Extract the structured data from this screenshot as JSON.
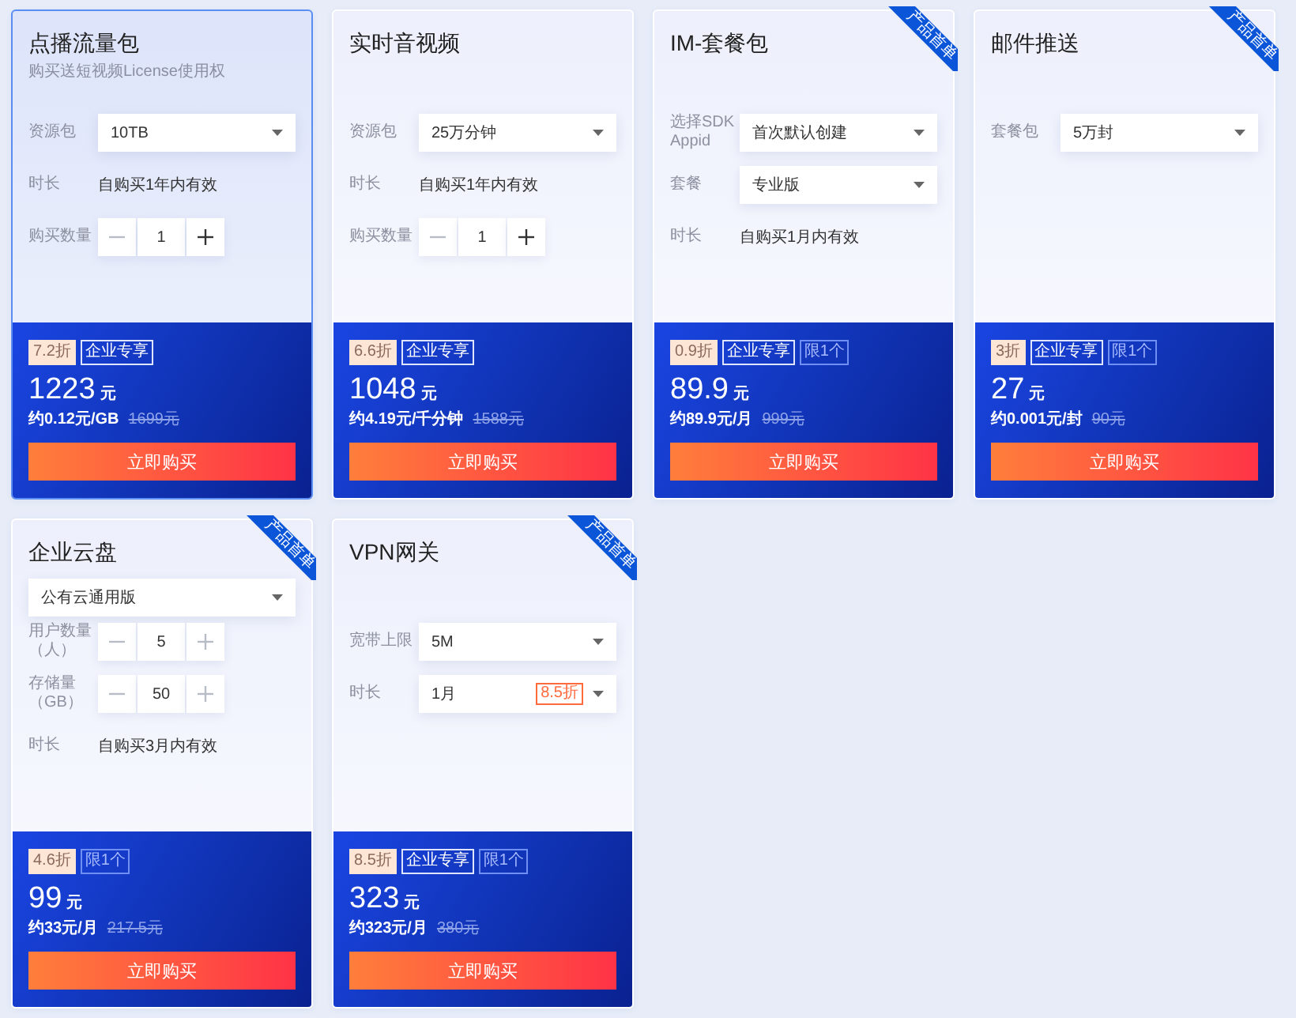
{
  "cards": [
    {
      "title": "点播流量包",
      "subtitle": "购买送短视频License使用权",
      "selected": true,
      "fields": [
        {
          "kind": "select",
          "label": "资源包",
          "value": "10TB"
        },
        {
          "kind": "text",
          "label": "时长",
          "value": "自购买1年内有效"
        },
        {
          "kind": "stepper",
          "label": "购买数量",
          "value": "1",
          "minus_disabled": true,
          "plus_disabled": false
        }
      ],
      "tags": [
        {
          "kind": "discount",
          "text": "7.2折"
        },
        {
          "kind": "exclusive",
          "text": "企业专享"
        }
      ],
      "price": "1223",
      "currency": "元",
      "unit_price": "约0.12元/GB",
      "original_price": "1699元",
      "button": "立即购买"
    },
    {
      "title": "实时音视频",
      "selected": false,
      "fields": [
        {
          "kind": "select",
          "label": "资源包",
          "value": "25万分钟"
        },
        {
          "kind": "text",
          "label": "时长",
          "value": "自购买1年内有效"
        },
        {
          "kind": "stepper",
          "label": "购买数量",
          "value": "1",
          "minus_disabled": true,
          "plus_disabled": false
        }
      ],
      "tags": [
        {
          "kind": "discount",
          "text": "6.6折"
        },
        {
          "kind": "exclusive",
          "text": "企业专享"
        }
      ],
      "price": "1048",
      "currency": "元",
      "unit_price": "约4.19元/千分钟",
      "original_price": "1588元",
      "button": "立即购买"
    },
    {
      "title": "IM-套餐包",
      "ribbon": "产品首单",
      "selected": false,
      "fields": [
        {
          "kind": "select",
          "label": "选择SDK Appid",
          "value": "首次默认创建"
        },
        {
          "kind": "select",
          "label": "套餐",
          "value": "专业版"
        },
        {
          "kind": "text",
          "label": "时长",
          "value": "自购买1月内有效"
        }
      ],
      "tags": [
        {
          "kind": "discount",
          "text": "0.9折"
        },
        {
          "kind": "exclusive",
          "text": "企业专享"
        },
        {
          "kind": "limit",
          "text": "限1个"
        }
      ],
      "price": "89.9",
      "currency": "元",
      "unit_price": "约89.9元/月",
      "original_price": "999元",
      "button": "立即购买"
    },
    {
      "title": "邮件推送",
      "ribbon": "产品首单",
      "selected": false,
      "fields": [
        {
          "kind": "select",
          "label": "套餐包",
          "value": "5万封"
        }
      ],
      "tags": [
        {
          "kind": "discount",
          "text": "3折"
        },
        {
          "kind": "exclusive",
          "text": "企业专享"
        },
        {
          "kind": "limit",
          "text": "限1个"
        }
      ],
      "price": "27",
      "currency": "元",
      "unit_price": "约0.001元/封",
      "original_price": "90元",
      "button": "立即购买"
    },
    {
      "title": "企业云盘",
      "ribbon": "产品首单",
      "selected": false,
      "edition": "公有云通用版",
      "fields": [
        {
          "kind": "stepper",
          "label": "用户数量（人）",
          "value": "5",
          "minus_disabled": true,
          "plus_disabled": true
        },
        {
          "kind": "stepper",
          "label": "存储量（GB）",
          "value": "50",
          "minus_disabled": true,
          "plus_disabled": true
        },
        {
          "kind": "text",
          "label": "时长",
          "value": "自购买3月内有效"
        }
      ],
      "tags": [
        {
          "kind": "discount",
          "text": "4.6折"
        },
        {
          "kind": "limit",
          "text": "限1个"
        }
      ],
      "price": "99",
      "currency": "元",
      "unit_price": "约33元/月",
      "original_price": "217.5元",
      "button": "立即购买"
    },
    {
      "title": "VPN网关",
      "ribbon": "产品首单",
      "selected": false,
      "fields": [
        {
          "kind": "select",
          "label": "宽带上限",
          "value": "5M"
        },
        {
          "kind": "select",
          "label": "时长",
          "value": "1月",
          "tag": "8.5折"
        }
      ],
      "tags": [
        {
          "kind": "discount",
          "text": "8.5折"
        },
        {
          "kind": "exclusive",
          "text": "企业专享"
        },
        {
          "kind": "limit",
          "text": "限1个"
        }
      ],
      "price": "323",
      "currency": "元",
      "unit_price": "约323元/月",
      "original_price": "380元",
      "button": "立即购买"
    }
  ]
}
